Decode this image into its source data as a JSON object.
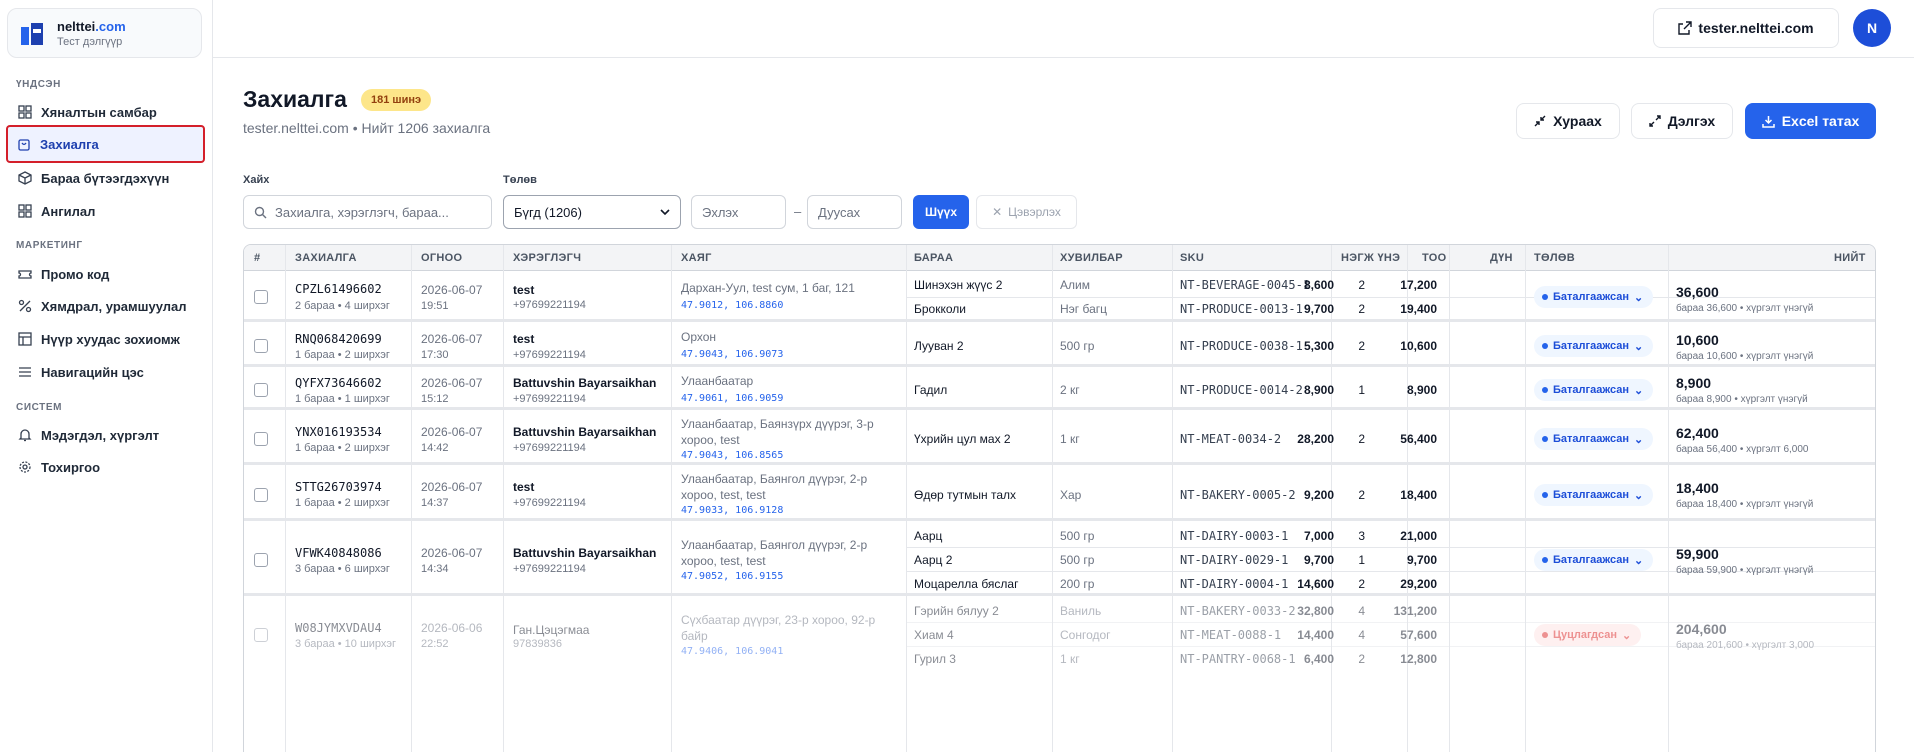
{
  "brand": {
    "name_prefix": "nelttei",
    "name_suffix": ".com",
    "subtitle": "Тест дэлгүүр"
  },
  "sidebar": {
    "sections": [
      {
        "label": "ҮНДСЭН"
      },
      {
        "label": "МАРКЕТИНГ"
      },
      {
        "label": "СИСТЕМ"
      }
    ],
    "items": [
      {
        "label": "Хяналтын самбар",
        "icon": "grid-icon"
      },
      {
        "label": "Захиалга",
        "icon": "bag-icon",
        "active": true
      },
      {
        "label": "Бараа бүтээгдэхүүн",
        "icon": "box-icon"
      },
      {
        "label": "Ангилал",
        "icon": "grid-icon"
      },
      {
        "label": "Промо код",
        "icon": "ticket-icon"
      },
      {
        "label": "Хямдрал, урамшуулал",
        "icon": "percent-icon"
      },
      {
        "label": "Нүүр хуудас зохиомж",
        "icon": "layout-icon"
      },
      {
        "label": "Навигацийн цэс",
        "icon": "menu-icon"
      },
      {
        "label": "Мэдэгдэл, хүргэлт",
        "icon": "bell-icon"
      },
      {
        "label": "Тохиргоо",
        "icon": "gear-icon"
      }
    ]
  },
  "topbar": {
    "site_label": "tester.nelttei.com",
    "avatar": "N"
  },
  "header": {
    "title": "Захиалга",
    "badge": "181 шинэ",
    "subtitle": "tester.nelttei.com • Нийт 1206 захиалга",
    "collapse_label": "Хураах",
    "expand_label": "Дэлгэх",
    "export_label": "Excel татах"
  },
  "filters": {
    "search_label": "Хайх",
    "search_placeholder": "Захиалга, хэрэглэгч, бараа...",
    "status_label": "Төлөв",
    "status_value": "Бүгд (1206)",
    "date_from": "Эхлэх",
    "date_sep": "–",
    "date_to": "Дуусах",
    "filter_btn": "Шүүх",
    "clear_btn": "Цэвэрлэх"
  },
  "table": {
    "columns": [
      "#",
      "ЗАХИАЛГА",
      "ОГНОО",
      "ХЭРЭГЛЭГЧ",
      "ХАЯГ",
      "БАРАА",
      "ХУВИЛБАР",
      "SKU",
      "НЭГЖ ҮНЭ",
      "ТОО",
      "ДҮН",
      "ТӨЛӨВ",
      "НИЙТ"
    ],
    "rows": [
      {
        "code": "CPZL61496602",
        "items_info": "2 бараа • 4 ширхэг",
        "date": "2026-06-07",
        "time": "19:51",
        "customer": "test",
        "phone": "+97699221194",
        "address": "Дархан-Уул, test сум, 1 баг, 121",
        "coords": "47.9012, 106.8860",
        "products": [
          {
            "name": "Шинэхэн жүүс 2",
            "variant": "Алим",
            "sku": "NT-BEVERAGE-0045-1",
            "unit": "8,600",
            "qty": "2",
            "amount": "17,200"
          },
          {
            "name": "Брокколи",
            "variant": "Нэг багц",
            "sku": "NT-PRODUCE-0013-1",
            "unit": "9,700",
            "qty": "2",
            "amount": "19,400"
          }
        ],
        "status": "Баталгаажсан",
        "total": "36,600",
        "total_sub": "бараа 36,600 • хүргэлт үнэгүй"
      },
      {
        "code": "RNQ068420699",
        "items_info": "1 бараа • 2 ширхэг",
        "date": "2026-06-07",
        "time": "17:30",
        "customer": "test",
        "phone": "+97699221194",
        "address": "Орхон",
        "coords": "47.9043, 106.9073",
        "products": [
          {
            "name": "Лууван 2",
            "variant": "500 гр",
            "sku": "NT-PRODUCE-0038-1",
            "unit": "5,300",
            "qty": "2",
            "amount": "10,600"
          }
        ],
        "status": "Баталгаажсан",
        "total": "10,600",
        "total_sub": "бараа 10,600 • хүргэлт үнэгүй"
      },
      {
        "code": "QYFX73646602",
        "items_info": "1 бараа • 1 ширхэг",
        "date": "2026-06-07",
        "time": "15:12",
        "customer": "Battuvshin Bayarsaikhan",
        "phone": "+97699221194",
        "address": "Улаанбаатар",
        "coords": "47.9061, 106.9059",
        "products": [
          {
            "name": "Гадил",
            "variant": "2 кг",
            "sku": "NT-PRODUCE-0014-2",
            "unit": "8,900",
            "qty": "1",
            "amount": "8,900"
          }
        ],
        "status": "Баталгаажсан",
        "total": "8,900",
        "total_sub": "бараа 8,900 • хүргэлт үнэгүй"
      },
      {
        "code": "YNX016193534",
        "items_info": "1 бараа • 2 ширхэг",
        "date": "2026-06-07",
        "time": "14:42",
        "customer": "Battuvshin Bayarsaikhan",
        "phone": "+97699221194",
        "address_1": "Улаанбаатар, Баянзүрх дүүрэг, 3-р",
        "address_2": "хороо, test",
        "coords": "47.9043, 106.8565",
        "products": [
          {
            "name": "Үхрийн цул мах 2",
            "variant": "1 кг",
            "sku": "NT-MEAT-0034-2",
            "unit": "28,200",
            "qty": "2",
            "amount": "56,400"
          }
        ],
        "status": "Баталгаажсан",
        "total": "62,400",
        "total_sub": "бараа 56,400 • хүргэлт 6,000"
      },
      {
        "code": "STTG26703974",
        "items_info": "1 бараа • 2 ширхэг",
        "date": "2026-06-07",
        "time": "14:37",
        "customer": "test",
        "phone": "+97699221194",
        "address_1": "Улаанбаатар, Баянгол дүүрэг, 2-р",
        "address_2": "хороо, test, test",
        "coords": "47.9033, 106.9128",
        "products": [
          {
            "name": "Өдөр тутмын талх",
            "variant": "Хар",
            "sku": "NT-BAKERY-0005-2",
            "unit": "9,200",
            "qty": "2",
            "amount": "18,400"
          }
        ],
        "status": "Баталгаажсан",
        "total": "18,400",
        "total_sub": "бараа 18,400 • хүргэлт үнэгүй"
      },
      {
        "code": "VFWK40848086",
        "items_info": "3 бараа • 6 ширхэг",
        "date": "2026-06-07",
        "time": "14:34",
        "customer": "Battuvshin Bayarsaikhan",
        "phone": "+97699221194",
        "address_1": "Улаанбаатар, Баянгол дүүрэг, 2-р",
        "address_2": "хороо, test, test",
        "coords": "47.9052, 106.9155",
        "products": [
          {
            "name": "Аарц",
            "variant": "500 гр",
            "sku": "NT-DAIRY-0003-1",
            "unit": "7,000",
            "qty": "3",
            "amount": "21,000"
          },
          {
            "name": "Аарц 2",
            "variant": "500 гр",
            "sku": "NT-DAIRY-0029-1",
            "unit": "9,700",
            "qty": "1",
            "amount": "9,700"
          },
          {
            "name": "Моцарелла бяслаг",
            "variant": "200 гр",
            "sku": "NT-DAIRY-0004-1",
            "unit": "14,600",
            "qty": "2",
            "amount": "29,200"
          }
        ],
        "status": "Баталгаажсан",
        "total": "59,900",
        "total_sub": "бараа 59,900 • хүргэлт үнэгүй"
      },
      {
        "code": "W08JYMXVDAU4",
        "items_info": "3 бараа • 10 ширхэг",
        "date": "2026-06-06",
        "time": "22:52",
        "customer": "Ган.Цэцэгмаа",
        "phone": "97839836",
        "address_1": "Сүхбаатар дүүрэг, 23-р хороо, 92-р",
        "address_2": "байр",
        "coords": "47.9406, 106.9041",
        "products": [
          {
            "name": "Гэрийн бялуу 2",
            "variant": "Ваниль",
            "sku": "NT-BAKERY-0033-2",
            "unit": "32,800",
            "qty": "4",
            "amount": "131,200"
          },
          {
            "name": "Хиам 4",
            "variant": "Сонгодог",
            "sku": "NT-MEAT-0088-1",
            "unit": "14,400",
            "qty": "4",
            "amount": "57,600"
          },
          {
            "name": "Гурил 3",
            "variant": "1 кг",
            "sku": "NT-PANTRY-0068-1",
            "unit": "6,400",
            "qty": "2",
            "amount": "12,800"
          }
        ],
        "status": "Цуцлагдсан",
        "total": "204,600",
        "total_sub": "бараа 201,600 • хүргэлт 3,000"
      }
    ]
  }
}
